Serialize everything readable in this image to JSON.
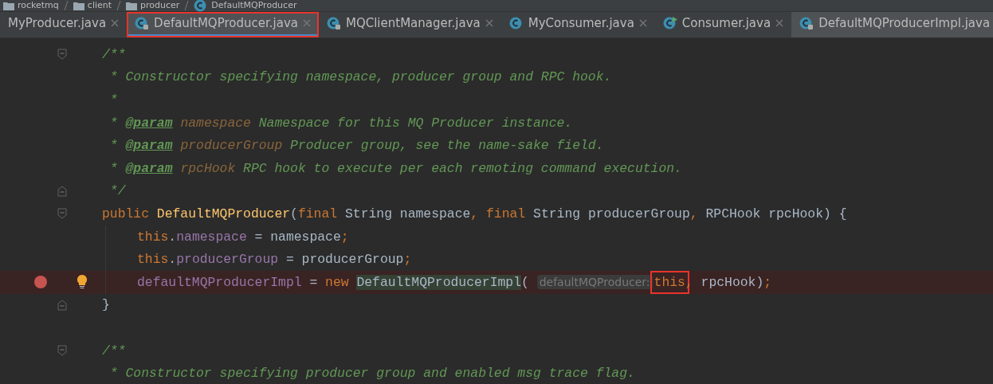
{
  "breadcrumb": [
    {
      "label": "rocketmq",
      "kind": "folder"
    },
    {
      "label": "client",
      "kind": "folder"
    },
    {
      "label": "producer",
      "kind": "folder"
    },
    {
      "label": "DefaultMQProducer",
      "kind": "class"
    }
  ],
  "tabs": [
    {
      "label": "MyProducer.java",
      "kind": "plain",
      "locked": false,
      "closable": true,
      "selected": false,
      "boxed": false
    },
    {
      "label": "DefaultMQProducer.java",
      "kind": "class",
      "locked": true,
      "closable": true,
      "selected": true,
      "boxed": true
    },
    {
      "label": "MQClientManager.java",
      "kind": "class",
      "locked": true,
      "closable": true,
      "selected": false,
      "boxed": false
    },
    {
      "label": "MyConsumer.java",
      "kind": "class",
      "locked": false,
      "closable": true,
      "selected": false,
      "boxed": false
    },
    {
      "label": "Consumer.java",
      "kind": "class-run",
      "locked": false,
      "closable": true,
      "selected": false,
      "boxed": false
    },
    {
      "label": "DefaultMQProducerImpl.java",
      "kind": "class",
      "locked": true,
      "closable": false,
      "selected": false,
      "boxed": false
    }
  ],
  "lines": [
    {
      "kind": "fold-start",
      "breakpoint": false,
      "bulb": false,
      "tokens": [
        {
          "kind": "comment",
          "text": "/**"
        }
      ]
    },
    {
      "kind": "code",
      "breakpoint": false,
      "bulb": false,
      "tokens": [
        {
          "kind": "comment",
          "text": " * Constructor specifying namespace, producer group and RPC hook."
        }
      ]
    },
    {
      "kind": "code",
      "breakpoint": false,
      "bulb": false,
      "tokens": [
        {
          "kind": "comment",
          "text": " *"
        }
      ]
    },
    {
      "kind": "code",
      "breakpoint": false,
      "bulb": false,
      "tokens": [
        {
          "kind": "comment",
          "text": " * "
        },
        {
          "kind": "tag",
          "text": "@param"
        },
        {
          "kind": "param",
          "text": " namespace"
        },
        {
          "kind": "comment",
          "text": " Namespace for this MQ Producer instance."
        }
      ]
    },
    {
      "kind": "code",
      "breakpoint": false,
      "bulb": false,
      "tokens": [
        {
          "kind": "comment",
          "text": " * "
        },
        {
          "kind": "tag",
          "text": "@param"
        },
        {
          "kind": "param",
          "text": " producerGroup"
        },
        {
          "kind": "comment",
          "text": " Producer group, see the name-sake field."
        }
      ]
    },
    {
      "kind": "code",
      "breakpoint": false,
      "bulb": false,
      "tokens": [
        {
          "kind": "comment",
          "text": " * "
        },
        {
          "kind": "tag",
          "text": "@param"
        },
        {
          "kind": "param",
          "text": " rpcHook"
        },
        {
          "kind": "comment",
          "text": " RPC hook to execute per each remoting command execution."
        }
      ]
    },
    {
      "kind": "fold-end",
      "breakpoint": false,
      "bulb": false,
      "tokens": [
        {
          "kind": "comment",
          "text": " */"
        }
      ]
    },
    {
      "kind": "fold-start",
      "breakpoint": false,
      "bulb": false,
      "tokens": [
        {
          "kind": "keyword",
          "text": "public "
        },
        {
          "kind": "function",
          "text": "DefaultMQProducer"
        },
        {
          "kind": "plain",
          "text": "("
        },
        {
          "kind": "keyword",
          "text": "final "
        },
        {
          "kind": "plain",
          "text": "String namespace"
        },
        {
          "kind": "keyword",
          "text": ", final "
        },
        {
          "kind": "plain",
          "text": "String producerGroup"
        },
        {
          "kind": "keyword",
          "text": ", "
        },
        {
          "kind": "plain",
          "text": "RPCHook rpcHook) {"
        }
      ],
      "children": [
        {
          "breakpoint": false,
          "bulb": false,
          "tokens": [
            {
              "kind": "keyword",
              "text": "this"
            },
            {
              "kind": "plain",
              "text": "."
            },
            {
              "kind": "field",
              "text": "namespace"
            },
            {
              "kind": "plain",
              "text": " = namespace"
            },
            {
              "kind": "keyword",
              "text": ";"
            }
          ]
        },
        {
          "breakpoint": false,
          "bulb": false,
          "tokens": [
            {
              "kind": "keyword",
              "text": "this"
            },
            {
              "kind": "plain",
              "text": "."
            },
            {
              "kind": "field",
              "text": "producerGroup"
            },
            {
              "kind": "plain",
              "text": " = producerGroup"
            },
            {
              "kind": "keyword",
              "text": ";"
            }
          ]
        },
        {
          "breakpoint": true,
          "bulb": true,
          "tokens": [
            {
              "kind": "field",
              "text": "defaultMQProducerImpl"
            },
            {
              "kind": "plain",
              "text": " = "
            },
            {
              "kind": "keyword",
              "text": "new "
            },
            {
              "kind": "usage",
              "text": "DefaultMQProducerImpl"
            },
            {
              "kind": "plain",
              "text": "( "
            },
            {
              "kind": "hint",
              "text": "defaultMQProducer:"
            },
            {
              "kind": "boxed",
              "text": "this"
            },
            {
              "kind": "keyword",
              "text": ","
            },
            {
              "kind": "plain",
              "text": " rpcHook)"
            },
            {
              "kind": "keyword",
              "text": ";"
            }
          ]
        }
      ]
    },
    {
      "kind": "fold-end",
      "breakpoint": false,
      "bulb": false,
      "tokens": [
        {
          "kind": "plain",
          "text": "}"
        }
      ]
    },
    {
      "kind": "code",
      "breakpoint": false,
      "bulb": false
    },
    {
      "kind": "fold-start",
      "breakpoint": false,
      "bulb": false,
      "tokens": [
        {
          "kind": "comment",
          "text": "/**"
        }
      ]
    },
    {
      "kind": "code",
      "breakpoint": false,
      "bulb": false,
      "tokens": [
        {
          "kind": "comment",
          "text": " * Constructor specifying producer group and enabled msg trace flag."
        }
      ]
    }
  ]
}
